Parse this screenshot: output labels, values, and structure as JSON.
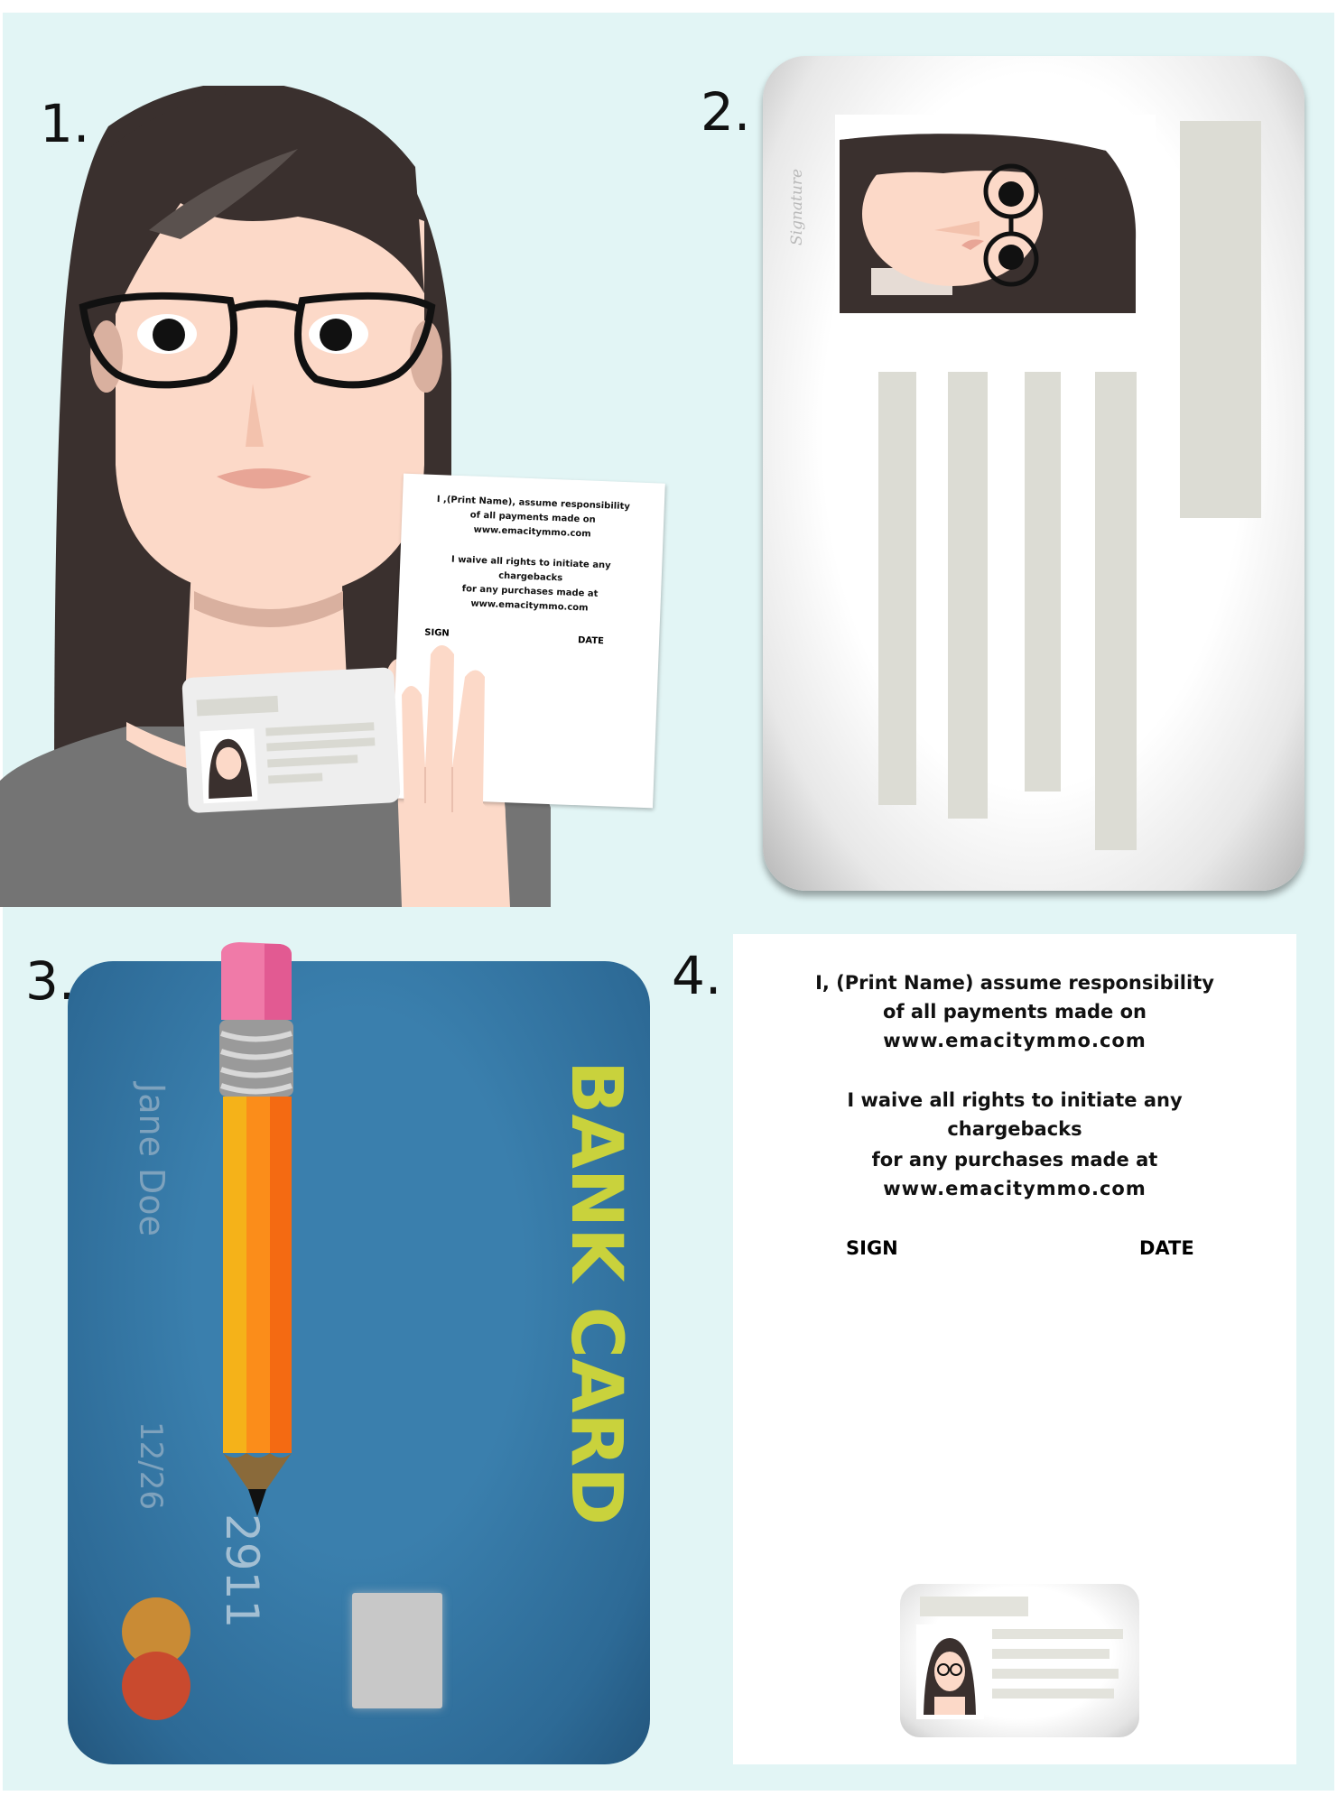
{
  "steps": [
    {
      "number": "1."
    },
    {
      "number": "2."
    },
    {
      "number": "3."
    },
    {
      "number": "4."
    }
  ],
  "form": {
    "small_lines": [
      "I ,(Print Name), assume responsibility",
      "of all payments made on",
      "www.emacitymmo.com",
      "I waive all rights to initiate any",
      "chargebacks",
      "for any purchases made at",
      "www.emacitymmo.com"
    ],
    "large_lines": [
      "I, (Print Name) assume responsibility",
      "of all payments made on",
      "www.emacitymmo.com",
      "I waive all rights to initiate any",
      "chargebacks",
      "for any purchases made at",
      "www.emacitymmo.com"
    ],
    "sign_label": "SIGN",
    "date_label": "DATE"
  },
  "id_card": {
    "signature": "Signature"
  },
  "bank_card": {
    "title": "BANK CARD",
    "holder_name": "Jane Doe",
    "expiry": "12/26",
    "number_fragment": "2911"
  },
  "colors": {
    "background": "#e2f5f5",
    "hair": "#3a302e",
    "skin": "#fcd9c8",
    "card_blue": "#2e6e9c",
    "card_title": "#c9d23c",
    "shirt": "#747474"
  }
}
